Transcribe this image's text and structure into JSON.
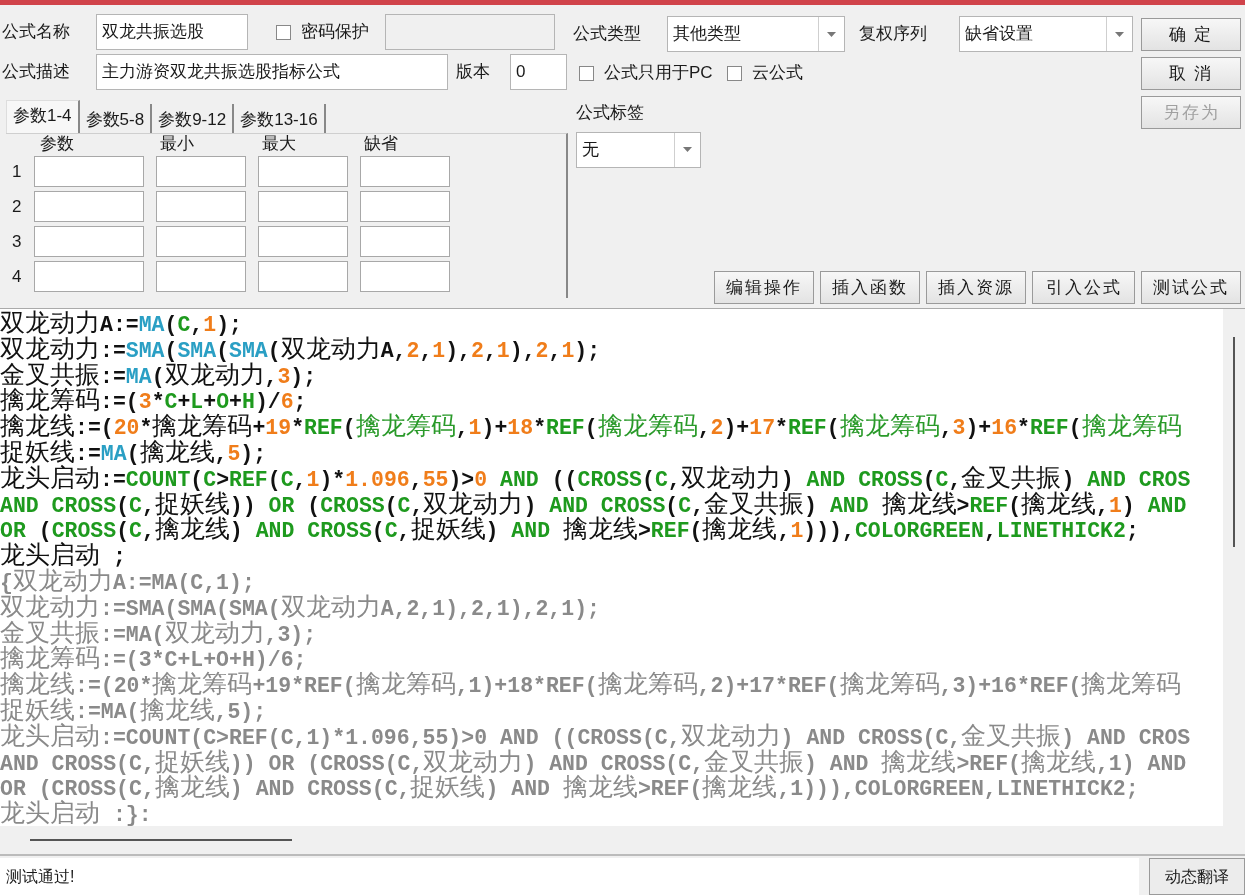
{
  "form": {
    "name_label": "公式名称",
    "name": "双龙共振选股",
    "password": {
      "label": "密码保护",
      "checked": false
    },
    "desc_label": "公式描述",
    "desc": "主力游资双龙共振选股指标公式",
    "version_label": "版本",
    "version": "0"
  },
  "param_tabs": [
    {
      "label": "参数1-4",
      "selected": true
    },
    {
      "label": "参数5-8",
      "selected": false
    },
    {
      "label": "参数9-12",
      "selected": false
    },
    {
      "label": "参数13-16",
      "selected": false
    }
  ],
  "param_columns": [
    "参数",
    "最小",
    "最大",
    "缺省"
  ],
  "param_rows": [
    "1",
    "2",
    "3",
    "4"
  ],
  "formula_type": {
    "label": "公式类型",
    "value": "其他类型"
  },
  "adjust_series": {
    "label": "复权序列",
    "value": "缺省设置"
  },
  "options": [
    {
      "label": "公式只用于PC",
      "checked": false
    },
    {
      "label": "云公式",
      "checked": false
    }
  ],
  "formula_tag": {
    "label": "公式标签",
    "value": "无"
  },
  "side_buttons": [
    {
      "label": "确 定",
      "disabled": false
    },
    {
      "label": "取 消",
      "disabled": false
    },
    {
      "label": "另存为",
      "disabled": true
    }
  ],
  "tool_buttons": [
    "编辑操作",
    "插入函数",
    "插入资源",
    "引入公式",
    "测试公式"
  ],
  "code_lines": [
    {
      "segments": [
        {
          "kind": "plain",
          "text": "双龙动力A:="
        },
        {
          "kind": "fn",
          "text": "MA"
        },
        {
          "kind": "plain",
          "text": "("
        },
        {
          "kind": "kw",
          "text": "C"
        },
        {
          "kind": "plain",
          "text": ","
        },
        {
          "kind": "num",
          "text": "1"
        },
        {
          "kind": "plain",
          "text": ");"
        }
      ]
    },
    {
      "segments": [
        {
          "kind": "plain",
          "text": "双龙动力:="
        },
        {
          "kind": "fn",
          "text": "SMA"
        },
        {
          "kind": "plain",
          "text": "("
        },
        {
          "kind": "fn",
          "text": "SMA"
        },
        {
          "kind": "plain",
          "text": "("
        },
        {
          "kind": "fn",
          "text": "SMA"
        },
        {
          "kind": "plain",
          "text": "(双龙动力A,"
        },
        {
          "kind": "num",
          "text": "2"
        },
        {
          "kind": "plain",
          "text": ","
        },
        {
          "kind": "num",
          "text": "1"
        },
        {
          "kind": "plain",
          "text": "),"
        },
        {
          "kind": "num",
          "text": "2"
        },
        {
          "kind": "plain",
          "text": ","
        },
        {
          "kind": "num",
          "text": "1"
        },
        {
          "kind": "plain",
          "text": "),"
        },
        {
          "kind": "num",
          "text": "2"
        },
        {
          "kind": "plain",
          "text": ","
        },
        {
          "kind": "num",
          "text": "1"
        },
        {
          "kind": "plain",
          "text": ");"
        }
      ]
    },
    {
      "segments": [
        {
          "kind": "plain",
          "text": "金叉共振:="
        },
        {
          "kind": "fn",
          "text": "MA"
        },
        {
          "kind": "plain",
          "text": "(双龙动力,"
        },
        {
          "kind": "num",
          "text": "3"
        },
        {
          "kind": "plain",
          "text": ");"
        }
      ]
    },
    {
      "segments": [
        {
          "kind": "plain",
          "text": "擒龙筹码:=("
        },
        {
          "kind": "num",
          "text": "3"
        },
        {
          "kind": "plain",
          "text": "*"
        },
        {
          "kind": "kw",
          "text": "C"
        },
        {
          "kind": "plain",
          "text": "+"
        },
        {
          "kind": "kw",
          "text": "L"
        },
        {
          "kind": "plain",
          "text": "+"
        },
        {
          "kind": "kw",
          "text": "O"
        },
        {
          "kind": "plain",
          "text": "+"
        },
        {
          "kind": "kw",
          "text": "H"
        },
        {
          "kind": "plain",
          "text": ")/"
        },
        {
          "kind": "num",
          "text": "6"
        },
        {
          "kind": "plain",
          "text": ";"
        }
      ]
    },
    {
      "segments": [
        {
          "kind": "plain",
          "text": "擒龙线:=("
        },
        {
          "kind": "num",
          "text": "20"
        },
        {
          "kind": "plain",
          "text": "*擒龙筹码+"
        },
        {
          "kind": "num",
          "text": "19"
        },
        {
          "kind": "plain",
          "text": "*"
        },
        {
          "kind": "kw",
          "text": "REF"
        },
        {
          "kind": "plain",
          "text": "("
        },
        {
          "kind": "var",
          "text": "擒龙筹码"
        },
        {
          "kind": "plain",
          "text": ","
        },
        {
          "kind": "num",
          "text": "1"
        },
        {
          "kind": "plain",
          "text": ")+"
        },
        {
          "kind": "num",
          "text": "18"
        },
        {
          "kind": "plain",
          "text": "*"
        },
        {
          "kind": "kw",
          "text": "REF"
        },
        {
          "kind": "plain",
          "text": "("
        },
        {
          "kind": "var",
          "text": "擒龙筹码"
        },
        {
          "kind": "plain",
          "text": ","
        },
        {
          "kind": "num",
          "text": "2"
        },
        {
          "kind": "plain",
          "text": ")+"
        },
        {
          "kind": "num",
          "text": "17"
        },
        {
          "kind": "plain",
          "text": "*"
        },
        {
          "kind": "kw",
          "text": "REF"
        },
        {
          "kind": "plain",
          "text": "("
        },
        {
          "kind": "var",
          "text": "擒龙筹码"
        },
        {
          "kind": "plain",
          "text": ","
        },
        {
          "kind": "num",
          "text": "3"
        },
        {
          "kind": "plain",
          "text": ")+"
        },
        {
          "kind": "num",
          "text": "16"
        },
        {
          "kind": "plain",
          "text": "*"
        },
        {
          "kind": "kw",
          "text": "REF"
        },
        {
          "kind": "plain",
          "text": "("
        },
        {
          "kind": "var",
          "text": "擒龙筹码"
        }
      ]
    },
    {
      "segments": [
        {
          "kind": "plain",
          "text": "捉妖线:="
        },
        {
          "kind": "fn",
          "text": "MA"
        },
        {
          "kind": "plain",
          "text": "(擒龙线,"
        },
        {
          "kind": "num",
          "text": "5"
        },
        {
          "kind": "plain",
          "text": ");"
        }
      ]
    },
    {
      "segments": [
        {
          "kind": "plain",
          "text": "龙头启动:="
        },
        {
          "kind": "kw",
          "text": "COUNT"
        },
        {
          "kind": "plain",
          "text": "("
        },
        {
          "kind": "kw",
          "text": "C"
        },
        {
          "kind": "plain",
          "text": ">"
        },
        {
          "kind": "kw",
          "text": "REF"
        },
        {
          "kind": "plain",
          "text": "("
        },
        {
          "kind": "kw",
          "text": "C"
        },
        {
          "kind": "plain",
          "text": ","
        },
        {
          "kind": "num",
          "text": "1"
        },
        {
          "kind": "plain",
          "text": ")*"
        },
        {
          "kind": "num",
          "text": "1.096"
        },
        {
          "kind": "plain",
          "text": ","
        },
        {
          "kind": "num",
          "text": "55"
        },
        {
          "kind": "plain",
          "text": ")>"
        },
        {
          "kind": "num",
          "text": "0"
        },
        {
          "kind": "kw",
          "text": " AND"
        },
        {
          "kind": "plain",
          "text": " (("
        },
        {
          "kind": "kw",
          "text": "CROSS"
        },
        {
          "kind": "plain",
          "text": "("
        },
        {
          "kind": "kw",
          "text": "C"
        },
        {
          "kind": "plain",
          "text": ",双龙动力) "
        },
        {
          "kind": "kw",
          "text": "AND CROSS"
        },
        {
          "kind": "plain",
          "text": "("
        },
        {
          "kind": "kw",
          "text": "C"
        },
        {
          "kind": "plain",
          "text": ",金叉共振) "
        },
        {
          "kind": "kw",
          "text": "AND CROS"
        }
      ]
    },
    {
      "segments": [
        {
          "kind": "kw",
          "text": "AND CROSS"
        },
        {
          "kind": "plain",
          "text": "("
        },
        {
          "kind": "kw",
          "text": "C"
        },
        {
          "kind": "plain",
          "text": ",捉妖线)) "
        },
        {
          "kind": "kw",
          "text": "OR"
        },
        {
          "kind": "plain",
          "text": " ("
        },
        {
          "kind": "kw",
          "text": "CROSS"
        },
        {
          "kind": "plain",
          "text": "("
        },
        {
          "kind": "kw",
          "text": "C"
        },
        {
          "kind": "plain",
          "text": ",双龙动力) "
        },
        {
          "kind": "kw",
          "text": "AND CROSS"
        },
        {
          "kind": "plain",
          "text": "("
        },
        {
          "kind": "kw",
          "text": "C"
        },
        {
          "kind": "plain",
          "text": ",金叉共振) "
        },
        {
          "kind": "kw",
          "text": "AND"
        },
        {
          "kind": "plain",
          "text": " 擒龙线>"
        },
        {
          "kind": "kw",
          "text": "REF"
        },
        {
          "kind": "plain",
          "text": "(擒龙线,"
        },
        {
          "kind": "num",
          "text": "1"
        },
        {
          "kind": "plain",
          "text": ") "
        },
        {
          "kind": "kw",
          "text": "AND"
        }
      ]
    },
    {
      "segments": [
        {
          "kind": "kw",
          "text": "OR"
        },
        {
          "kind": "plain",
          "text": " ("
        },
        {
          "kind": "kw",
          "text": "CROSS"
        },
        {
          "kind": "plain",
          "text": "("
        },
        {
          "kind": "kw",
          "text": "C"
        },
        {
          "kind": "plain",
          "text": ",擒龙线) "
        },
        {
          "kind": "kw",
          "text": "AND CROSS"
        },
        {
          "kind": "plain",
          "text": "("
        },
        {
          "kind": "kw",
          "text": "C"
        },
        {
          "kind": "plain",
          "text": ",捉妖线) "
        },
        {
          "kind": "kw",
          "text": "AND"
        },
        {
          "kind": "plain",
          "text": " 擒龙线>"
        },
        {
          "kind": "kw",
          "text": "REF"
        },
        {
          "kind": "plain",
          "text": "(擒龙线,"
        },
        {
          "kind": "num",
          "text": "1"
        },
        {
          "kind": "plain",
          "text": "))),"
        },
        {
          "kind": "kw",
          "text": "COLORGREEN"
        },
        {
          "kind": "plain",
          "text": ","
        },
        {
          "kind": "kw",
          "text": "LINETHICK2"
        },
        {
          "kind": "plain",
          "text": ";"
        }
      ]
    },
    {
      "segments": [
        {
          "kind": "plain",
          "text": "龙头启动 ;"
        }
      ]
    },
    {
      "segments": [
        {
          "kind": "comment",
          "text": "{双龙动力A:=MA(C,1);"
        }
      ]
    },
    {
      "segments": [
        {
          "kind": "comment",
          "text": "双龙动力:=SMA(SMA(SMA(双龙动力A,2,1),2,1),2,1);"
        }
      ]
    },
    {
      "segments": [
        {
          "kind": "comment",
          "text": "金叉共振:=MA(双龙动力,3);"
        }
      ]
    },
    {
      "segments": [
        {
          "kind": "comment",
          "text": "擒龙筹码:=(3*C+L+O+H)/6;"
        }
      ]
    },
    {
      "segments": [
        {
          "kind": "comment",
          "text": "擒龙线:=(20*擒龙筹码+19*REF(擒龙筹码,1)+18*REF(擒龙筹码,2)+17*REF(擒龙筹码,3)+16*REF(擒龙筹码"
        }
      ]
    },
    {
      "segments": [
        {
          "kind": "comment",
          "text": "捉妖线:=MA(擒龙线,5);"
        }
      ]
    },
    {
      "segments": [
        {
          "kind": "comment",
          "text": "龙头启动:=COUNT(C>REF(C,1)*1.096,55)>0 AND ((CROSS(C,双龙动力) AND CROSS(C,金叉共振) AND CROS"
        }
      ]
    },
    {
      "segments": [
        {
          "kind": "comment",
          "text": "AND CROSS(C,捉妖线)) OR (CROSS(C,双龙动力) AND CROSS(C,金叉共振) AND 擒龙线>REF(擒龙线,1) AND"
        }
      ]
    },
    {
      "segments": [
        {
          "kind": "comment",
          "text": "OR (CROSS(C,擒龙线) AND CROSS(C,捉妖线) AND 擒龙线>REF(擒龙线,1))),COLORGREEN,LINETHICK2;"
        }
      ]
    },
    {
      "segments": [
        {
          "kind": "comment",
          "text": "龙头启动 :}:"
        }
      ]
    }
  ],
  "status": "测试通过!",
  "translate_button": "动态翻译"
}
